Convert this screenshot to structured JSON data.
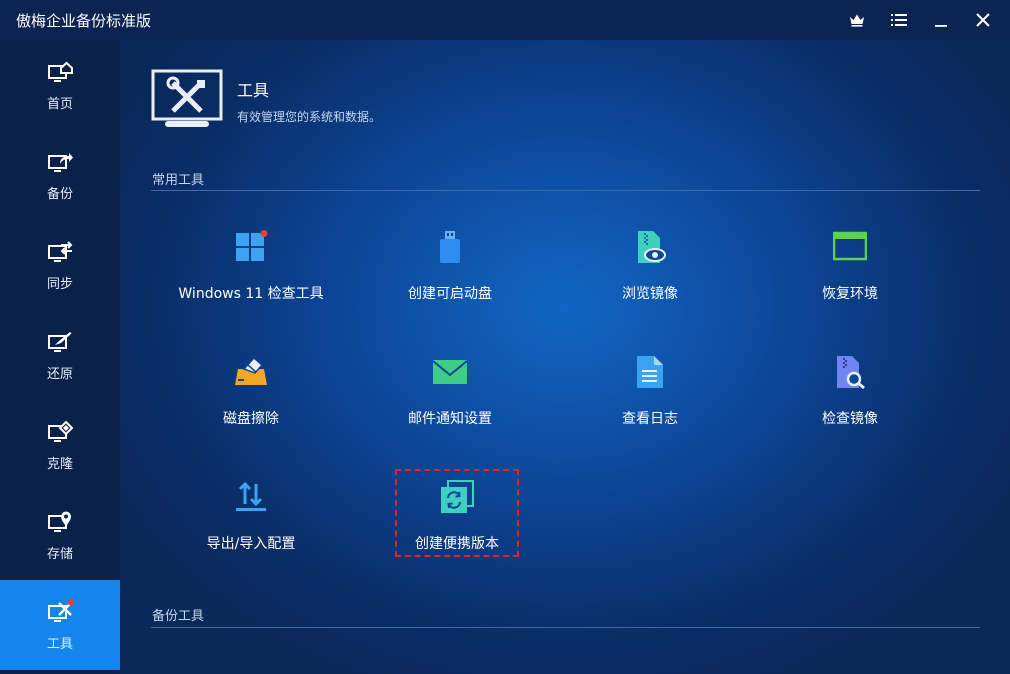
{
  "app": {
    "title": "傲梅企业备份标准版"
  },
  "window_controls": [
    {
      "name": "crown-icon"
    },
    {
      "name": "menu-icon"
    },
    {
      "name": "minimize-icon"
    },
    {
      "name": "close-icon"
    }
  ],
  "sidebar": {
    "items": [
      {
        "label": "首页",
        "icon": "home-monitor-icon"
      },
      {
        "label": "备份",
        "icon": "backup-monitor-icon"
      },
      {
        "label": "同步",
        "icon": "sync-monitor-icon"
      },
      {
        "label": "还原",
        "icon": "restore-monitor-icon"
      },
      {
        "label": "克隆",
        "icon": "clone-monitor-icon"
      },
      {
        "label": "存储",
        "icon": "storage-monitor-icon"
      },
      {
        "label": "工具",
        "icon": "tools-monitor-icon",
        "active": true
      }
    ]
  },
  "header": {
    "title": "工具",
    "description": "有效管理您的系统和数据。"
  },
  "sections": {
    "common": "常用工具",
    "backup": "备份工具"
  },
  "tools": [
    {
      "label": "Windows 11 检查工具",
      "icon": "windows-icon"
    },
    {
      "label": "创建可启动盘",
      "icon": "usb-drive-icon"
    },
    {
      "label": "浏览镜像",
      "icon": "explore-image-icon"
    },
    {
      "label": "恢复环境",
      "icon": "recovery-env-icon"
    },
    {
      "label": "磁盘擦除",
      "icon": "disk-wipe-icon"
    },
    {
      "label": "邮件通知设置",
      "icon": "mail-icon"
    },
    {
      "label": "查看日志",
      "icon": "log-file-icon"
    },
    {
      "label": "检查镜像",
      "icon": "check-image-icon"
    },
    {
      "label": "导出/导入配置",
      "icon": "export-import-icon"
    },
    {
      "label": "创建便携版本",
      "icon": "portable-version-icon",
      "highlighted": true
    }
  ],
  "colors": {
    "accent": "#1585ee",
    "highlight": "#e3232c",
    "badge": "#ef3b3b"
  }
}
